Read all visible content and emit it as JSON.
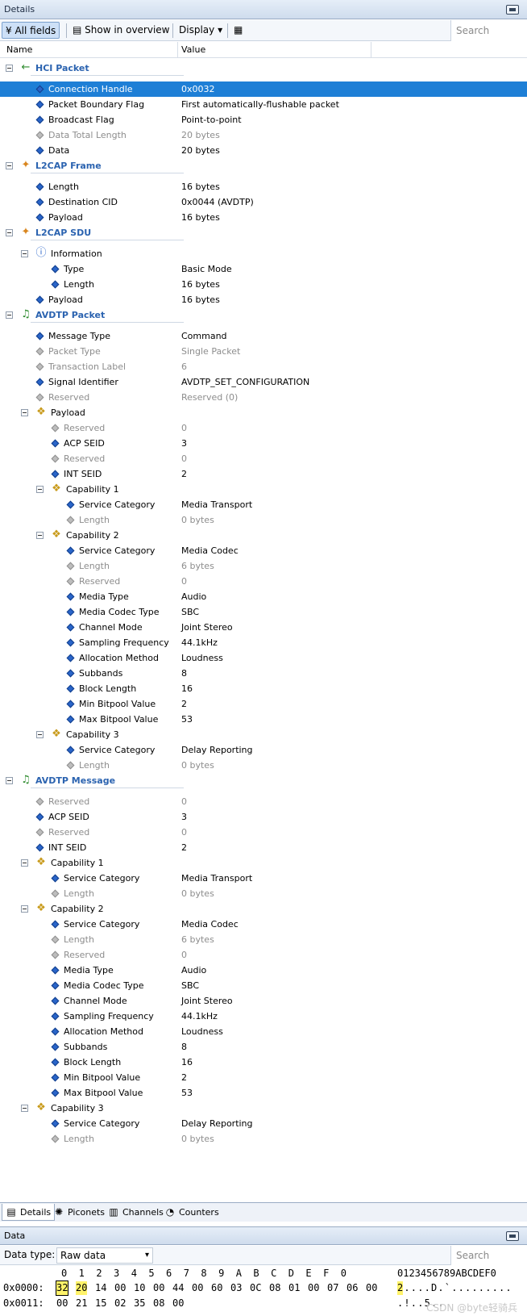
{
  "window_title": "Details",
  "toolbar": {
    "all_fields": "All fields",
    "show_overview": "Show in overview",
    "display": "Display",
    "search_placeholder": "Search"
  },
  "columns": {
    "name": "Name",
    "value": "Value"
  },
  "tree": [
    {
      "type": "section",
      "level": 0,
      "icon": "arrow-left-icon",
      "label": "HCI Packet"
    },
    {
      "type": "field",
      "level": 1,
      "label": "Connection Handle",
      "value": "0x0032",
      "selected": true
    },
    {
      "type": "field",
      "level": 1,
      "label": "Packet Boundary Flag",
      "value": "First automatically-flushable packet"
    },
    {
      "type": "field",
      "level": 1,
      "label": "Broadcast Flag",
      "value": "Point-to-point"
    },
    {
      "type": "field",
      "level": 1,
      "label": "Data Total Length",
      "value": "20 bytes",
      "dim": true
    },
    {
      "type": "field",
      "level": 1,
      "label": "Data",
      "value": "20 bytes"
    },
    {
      "type": "section",
      "level": 0,
      "icon": "l2cap-frame-icon",
      "label": "L2CAP Frame"
    },
    {
      "type": "field",
      "level": 1,
      "label": "Length",
      "value": "16 bytes"
    },
    {
      "type": "field",
      "level": 1,
      "label": "Destination CID",
      "value": "0x0044 (AVDTP)"
    },
    {
      "type": "field",
      "level": 1,
      "label": "Payload",
      "value": "16 bytes"
    },
    {
      "type": "section",
      "level": 0,
      "icon": "l2cap-sdu-icon",
      "label": "L2CAP SDU"
    },
    {
      "type": "group",
      "level": 1,
      "icon": "info-icon",
      "label": "Information"
    },
    {
      "type": "field",
      "level": 2,
      "label": "Type",
      "value": "Basic Mode"
    },
    {
      "type": "field",
      "level": 2,
      "label": "Length",
      "value": "16 bytes"
    },
    {
      "type": "field",
      "level": 1,
      "label": "Payload",
      "value": "16 bytes"
    },
    {
      "type": "section",
      "level": 0,
      "icon": "avdtp-music-icon",
      "label": "AVDTP Packet"
    },
    {
      "type": "field",
      "level": 1,
      "label": "Message Type",
      "value": "Command"
    },
    {
      "type": "field",
      "level": 1,
      "label": "Packet Type",
      "value": "Single Packet",
      "dim": true
    },
    {
      "type": "field",
      "level": 1,
      "label": "Transaction Label",
      "value": "6",
      "dim": true
    },
    {
      "type": "field",
      "level": 1,
      "label": "Signal Identifier",
      "value": "AVDTP_SET_CONFIGURATION"
    },
    {
      "type": "field",
      "level": 1,
      "label": "Reserved",
      "value": "Reserved (0)",
      "dim": true
    },
    {
      "type": "group",
      "level": 1,
      "icon": "struct-icon",
      "label": "Payload"
    },
    {
      "type": "field",
      "level": 2,
      "label": "Reserved",
      "value": "0",
      "dim": true
    },
    {
      "type": "field",
      "level": 2,
      "label": "ACP SEID",
      "value": "3"
    },
    {
      "type": "field",
      "level": 2,
      "label": "Reserved",
      "value": "0",
      "dim": true
    },
    {
      "type": "field",
      "level": 2,
      "label": "INT SEID",
      "value": "2"
    },
    {
      "type": "group",
      "level": 2,
      "icon": "struct-icon",
      "label": "Capability 1"
    },
    {
      "type": "field",
      "level": 3,
      "label": "Service Category",
      "value": "Media Transport"
    },
    {
      "type": "field",
      "level": 3,
      "label": "Length",
      "value": "0 bytes",
      "dim": true
    },
    {
      "type": "group",
      "level": 2,
      "icon": "struct-icon",
      "label": "Capability 2"
    },
    {
      "type": "field",
      "level": 3,
      "label": "Service Category",
      "value": "Media Codec"
    },
    {
      "type": "field",
      "level": 3,
      "label": "Length",
      "value": "6 bytes",
      "dim": true
    },
    {
      "type": "field",
      "level": 3,
      "label": "Reserved",
      "value": "0",
      "dim": true
    },
    {
      "type": "field",
      "level": 3,
      "label": "Media Type",
      "value": "Audio"
    },
    {
      "type": "field",
      "level": 3,
      "label": "Media Codec Type",
      "value": "SBC"
    },
    {
      "type": "field",
      "level": 3,
      "label": "Channel Mode",
      "value": "Joint Stereo"
    },
    {
      "type": "field",
      "level": 3,
      "label": "Sampling Frequency",
      "value": "44.1kHz"
    },
    {
      "type": "field",
      "level": 3,
      "label": "Allocation Method",
      "value": "Loudness"
    },
    {
      "type": "field",
      "level": 3,
      "label": "Subbands",
      "value": "8"
    },
    {
      "type": "field",
      "level": 3,
      "label": "Block Length",
      "value": "16"
    },
    {
      "type": "field",
      "level": 3,
      "label": "Min Bitpool Value",
      "value": "2"
    },
    {
      "type": "field",
      "level": 3,
      "label": "Max Bitpool Value",
      "value": "53"
    },
    {
      "type": "group",
      "level": 2,
      "icon": "struct-icon",
      "label": "Capability 3"
    },
    {
      "type": "field",
      "level": 3,
      "label": "Service Category",
      "value": "Delay Reporting"
    },
    {
      "type": "field",
      "level": 3,
      "label": "Length",
      "value": "0 bytes",
      "dim": true
    },
    {
      "type": "section",
      "level": 0,
      "icon": "avdtp-music-icon",
      "label": "AVDTP Message"
    },
    {
      "type": "field",
      "level": 1,
      "label": "Reserved",
      "value": "0",
      "dim": true
    },
    {
      "type": "field",
      "level": 1,
      "label": "ACP SEID",
      "value": "3"
    },
    {
      "type": "field",
      "level": 1,
      "label": "Reserved",
      "value": "0",
      "dim": true
    },
    {
      "type": "field",
      "level": 1,
      "label": "INT SEID",
      "value": "2"
    },
    {
      "type": "group",
      "level": 1,
      "icon": "struct-icon",
      "label": "Capability 1"
    },
    {
      "type": "field",
      "level": 2,
      "label": "Service Category",
      "value": "Media Transport"
    },
    {
      "type": "field",
      "level": 2,
      "label": "Length",
      "value": "0 bytes",
      "dim": true
    },
    {
      "type": "group",
      "level": 1,
      "icon": "struct-icon",
      "label": "Capability 2"
    },
    {
      "type": "field",
      "level": 2,
      "label": "Service Category",
      "value": "Media Codec"
    },
    {
      "type": "field",
      "level": 2,
      "label": "Length",
      "value": "6 bytes",
      "dim": true
    },
    {
      "type": "field",
      "level": 2,
      "label": "Reserved",
      "value": "0",
      "dim": true
    },
    {
      "type": "field",
      "level": 2,
      "label": "Media Type",
      "value": "Audio"
    },
    {
      "type": "field",
      "level": 2,
      "label": "Media Codec Type",
      "value": "SBC"
    },
    {
      "type": "field",
      "level": 2,
      "label": "Channel Mode",
      "value": "Joint Stereo"
    },
    {
      "type": "field",
      "level": 2,
      "label": "Sampling Frequency",
      "value": "44.1kHz"
    },
    {
      "type": "field",
      "level": 2,
      "label": "Allocation Method",
      "value": "Loudness"
    },
    {
      "type": "field",
      "level": 2,
      "label": "Subbands",
      "value": "8"
    },
    {
      "type": "field",
      "level": 2,
      "label": "Block Length",
      "value": "16"
    },
    {
      "type": "field",
      "level": 2,
      "label": "Min Bitpool Value",
      "value": "2"
    },
    {
      "type": "field",
      "level": 2,
      "label": "Max Bitpool Value",
      "value": "53"
    },
    {
      "type": "group",
      "level": 1,
      "icon": "struct-icon",
      "label": "Capability 3"
    },
    {
      "type": "field",
      "level": 2,
      "label": "Service Category",
      "value": "Delay Reporting"
    },
    {
      "type": "field",
      "level": 2,
      "label": "Length",
      "value": "0 bytes",
      "dim": true
    }
  ],
  "bottom_tabs": [
    {
      "label": "Details",
      "icon": "details-icon",
      "active": true
    },
    {
      "label": "Piconets",
      "icon": "piconets-icon",
      "active": false
    },
    {
      "label": "Channels",
      "icon": "channels-icon",
      "active": false
    },
    {
      "label": "Counters",
      "icon": "counters-icon",
      "active": false
    }
  ],
  "data_panel": {
    "title": "Data",
    "type_label": "Data type:",
    "type_value": "Raw data",
    "search_placeholder": "Search",
    "hex_header": "0  1  2  3  4  5  6  7  8  9  A  B  C  D  E  F  0",
    "ascii_header": "0123456789ABCDEF0",
    "rows": [
      {
        "offset": "0x0000:",
        "bytes": [
          "32",
          "20",
          "14",
          "00",
          "10",
          "00",
          "44",
          "00",
          "60",
          "03",
          "0C",
          "08",
          "01",
          "00",
          "07",
          "06",
          "00"
        ],
        "ascii": [
          "2",
          ".",
          ".",
          ".",
          ".",
          "D",
          ".",
          "`",
          ".",
          ".",
          ".",
          ".",
          ".",
          ".",
          ".",
          ".",
          "."
        ]
      },
      {
        "offset": "0x0011:",
        "bytes": [
          "00",
          "21",
          "15",
          "02",
          "35",
          "08",
          "00"
        ],
        "ascii": [
          ".",
          "!",
          ".",
          ".",
          "5",
          ".",
          "."
        ]
      }
    ]
  },
  "watermark": "CSDN @byte轻骑兵",
  "colors": {
    "accent": "#2b63b0",
    "selection": "#1e7fd6",
    "highlight": "#fff36a"
  }
}
